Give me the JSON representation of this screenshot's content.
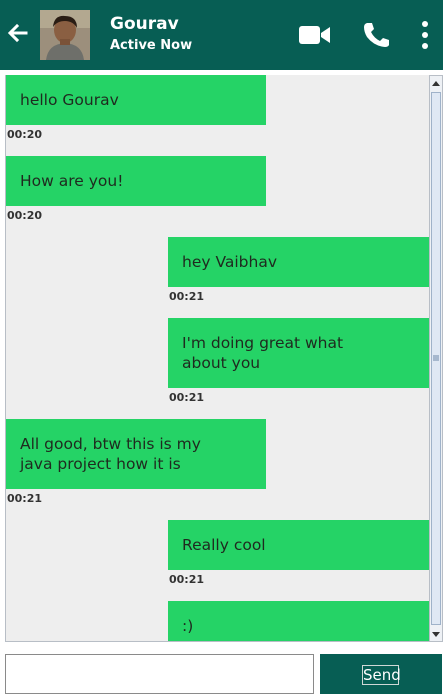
{
  "header": {
    "contact_name": "Gourav",
    "status": "Active Now",
    "icons": [
      "back-arrow-icon",
      "video-call-icon",
      "phone-icon",
      "more-vertical-icon"
    ]
  },
  "messages": [
    {
      "side": "left",
      "text": "hello Gourav",
      "time": "00:20"
    },
    {
      "side": "left",
      "text": "How are you!",
      "time": "00:20"
    },
    {
      "side": "right",
      "text": "hey Vaibhav",
      "time": "00:21"
    },
    {
      "side": "right",
      "text": "I'm doing great what\nabout you",
      "time": "00:21"
    },
    {
      "side": "left",
      "text": "All good, btw this is my\njava project how it is",
      "time": "00:21"
    },
    {
      "side": "right",
      "text": "Really cool",
      "time": "00:21"
    },
    {
      "side": "right",
      "text": ":)",
      "time": ""
    }
  ],
  "composer": {
    "input_value": "",
    "send_label": "Send"
  },
  "colors": {
    "header": "#075e54",
    "bubble": "#25d366",
    "chat_background": "#eeeeee"
  }
}
